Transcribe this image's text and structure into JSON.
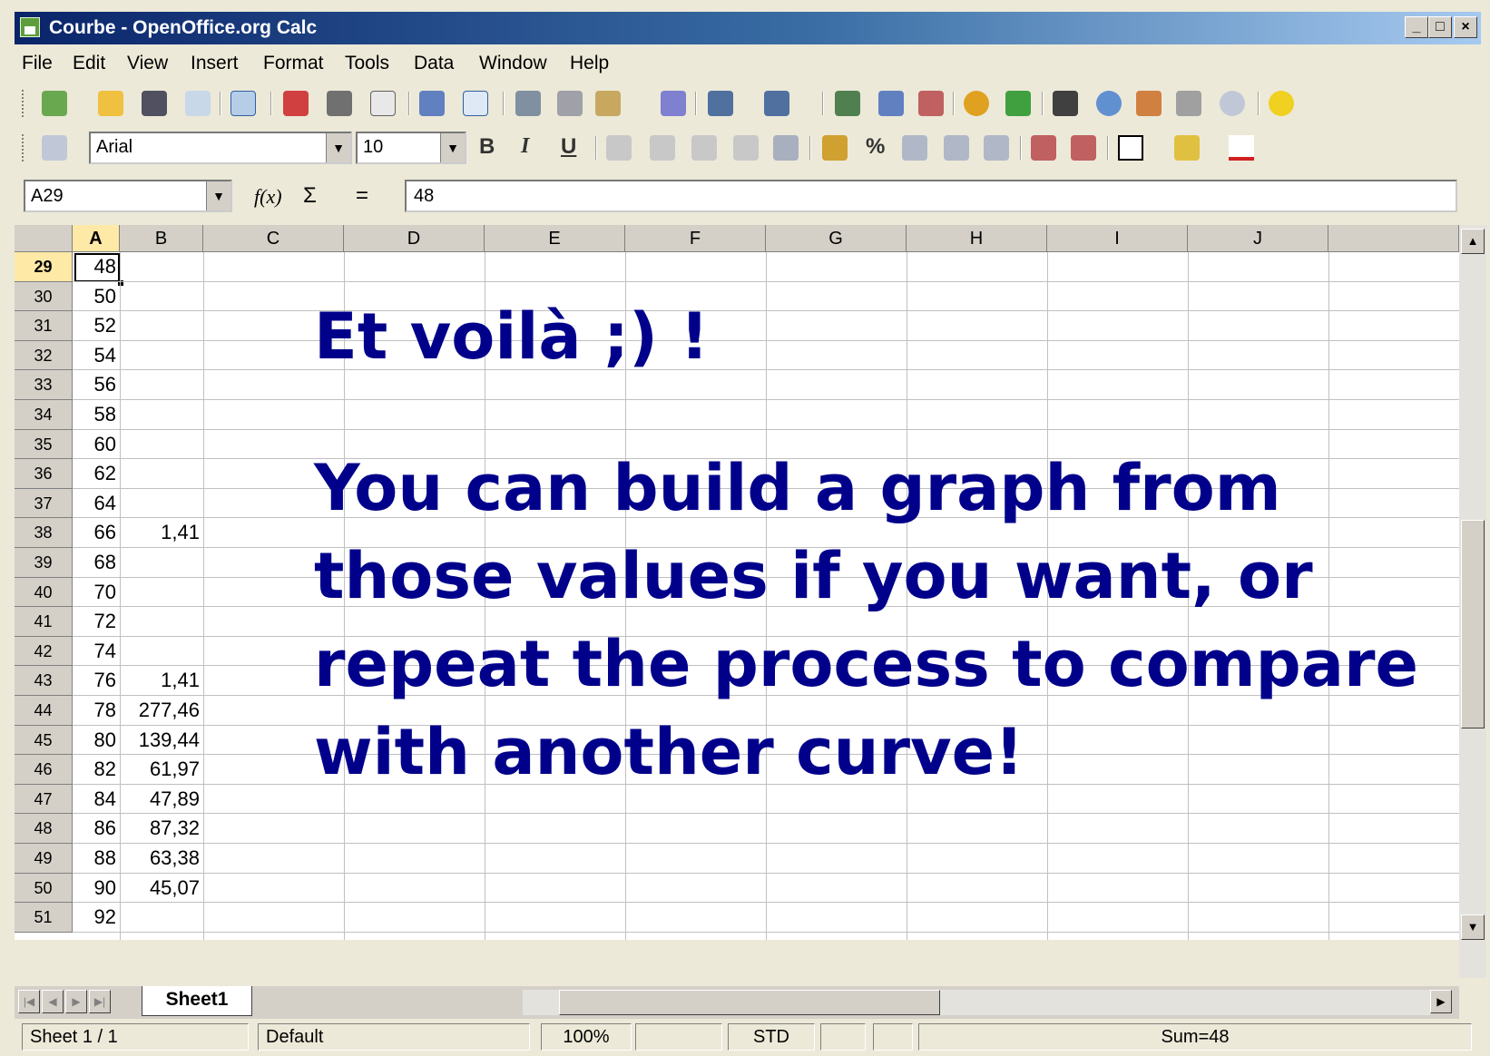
{
  "window": {
    "title": "Courbe - OpenOffice.org Calc",
    "minimize": "_",
    "maximize": "□",
    "close": "×"
  },
  "menu": [
    "File",
    "Edit",
    "View",
    "Insert",
    "Format",
    "Tools",
    "Data",
    "Window",
    "Help"
  ],
  "format_toolbar": {
    "font_name": "Arial",
    "font_size": "10",
    "bold": "B",
    "italic": "I",
    "underline": "U",
    "percent": "%"
  },
  "formula_bar": {
    "cell_ref": "A29",
    "function_wizard": "f(x)",
    "sum": "Σ",
    "equals": "=",
    "content": "48"
  },
  "columns": [
    "A",
    "B",
    "C",
    "D",
    "E",
    "F",
    "G",
    "H",
    "I",
    "J"
  ],
  "rows": [
    {
      "num": "29",
      "a": "48",
      "b": ""
    },
    {
      "num": "30",
      "a": "50",
      "b": ""
    },
    {
      "num": "31",
      "a": "52",
      "b": ""
    },
    {
      "num": "32",
      "a": "54",
      "b": ""
    },
    {
      "num": "33",
      "a": "56",
      "b": ""
    },
    {
      "num": "34",
      "a": "58",
      "b": ""
    },
    {
      "num": "35",
      "a": "60",
      "b": ""
    },
    {
      "num": "36",
      "a": "62",
      "b": ""
    },
    {
      "num": "37",
      "a": "64",
      "b": ""
    },
    {
      "num": "38",
      "a": "66",
      "b": "1,41"
    },
    {
      "num": "39",
      "a": "68",
      "b": ""
    },
    {
      "num": "40",
      "a": "70",
      "b": ""
    },
    {
      "num": "41",
      "a": "72",
      "b": ""
    },
    {
      "num": "42",
      "a": "74",
      "b": ""
    },
    {
      "num": "43",
      "a": "76",
      "b": "1,41"
    },
    {
      "num": "44",
      "a": "78",
      "b": "277,46"
    },
    {
      "num": "45",
      "a": "80",
      "b": "139,44"
    },
    {
      "num": "46",
      "a": "82",
      "b": "61,97"
    },
    {
      "num": "47",
      "a": "84",
      "b": "47,89"
    },
    {
      "num": "48",
      "a": "86",
      "b": "87,32"
    },
    {
      "num": "49",
      "a": "88",
      "b": "63,38"
    },
    {
      "num": "50",
      "a": "90",
      "b": "45,07"
    },
    {
      "num": "51",
      "a": "92",
      "b": ""
    }
  ],
  "overlay": {
    "heading": "Et voilà ;) !",
    "body": "You can build a graph from those values if you want, or repeat the process to compare with another curve!"
  },
  "sheet_tab": "Sheet1",
  "status": {
    "sheet": "Sheet 1 / 1",
    "style": "Default",
    "zoom": "100%",
    "mode": "STD",
    "sum": "Sum=48"
  }
}
